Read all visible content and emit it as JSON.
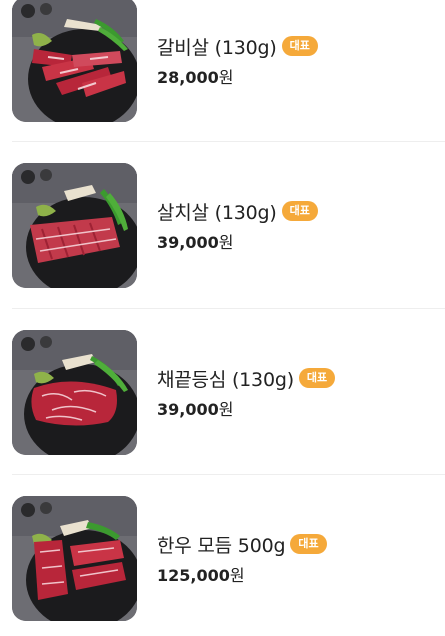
{
  "menu": {
    "items": [
      {
        "name": "갈비살 (130g)",
        "badge": "대표",
        "price": "28,000",
        "currency": "원",
        "image": "galbisal-photo"
      },
      {
        "name": "살치살 (130g)",
        "badge": "대표",
        "price": "39,000",
        "currency": "원",
        "image": "salchisal-photo"
      },
      {
        "name": "채끝등심 (130g)",
        "badge": "대표",
        "price": "39,000",
        "currency": "원",
        "image": "chaekkeut-photo"
      },
      {
        "name": "한우 모듬 500g",
        "badge": "대표",
        "price": "125,000",
        "currency": "원",
        "image": "hanwoo-platter-photo"
      }
    ]
  },
  "colors": {
    "badge": "#f5a93a",
    "text": "#222222",
    "divider": "#eeeeee",
    "plate": "#1b1b1d",
    "meat": "#b8263a",
    "pepper": "#3c9a2f"
  }
}
